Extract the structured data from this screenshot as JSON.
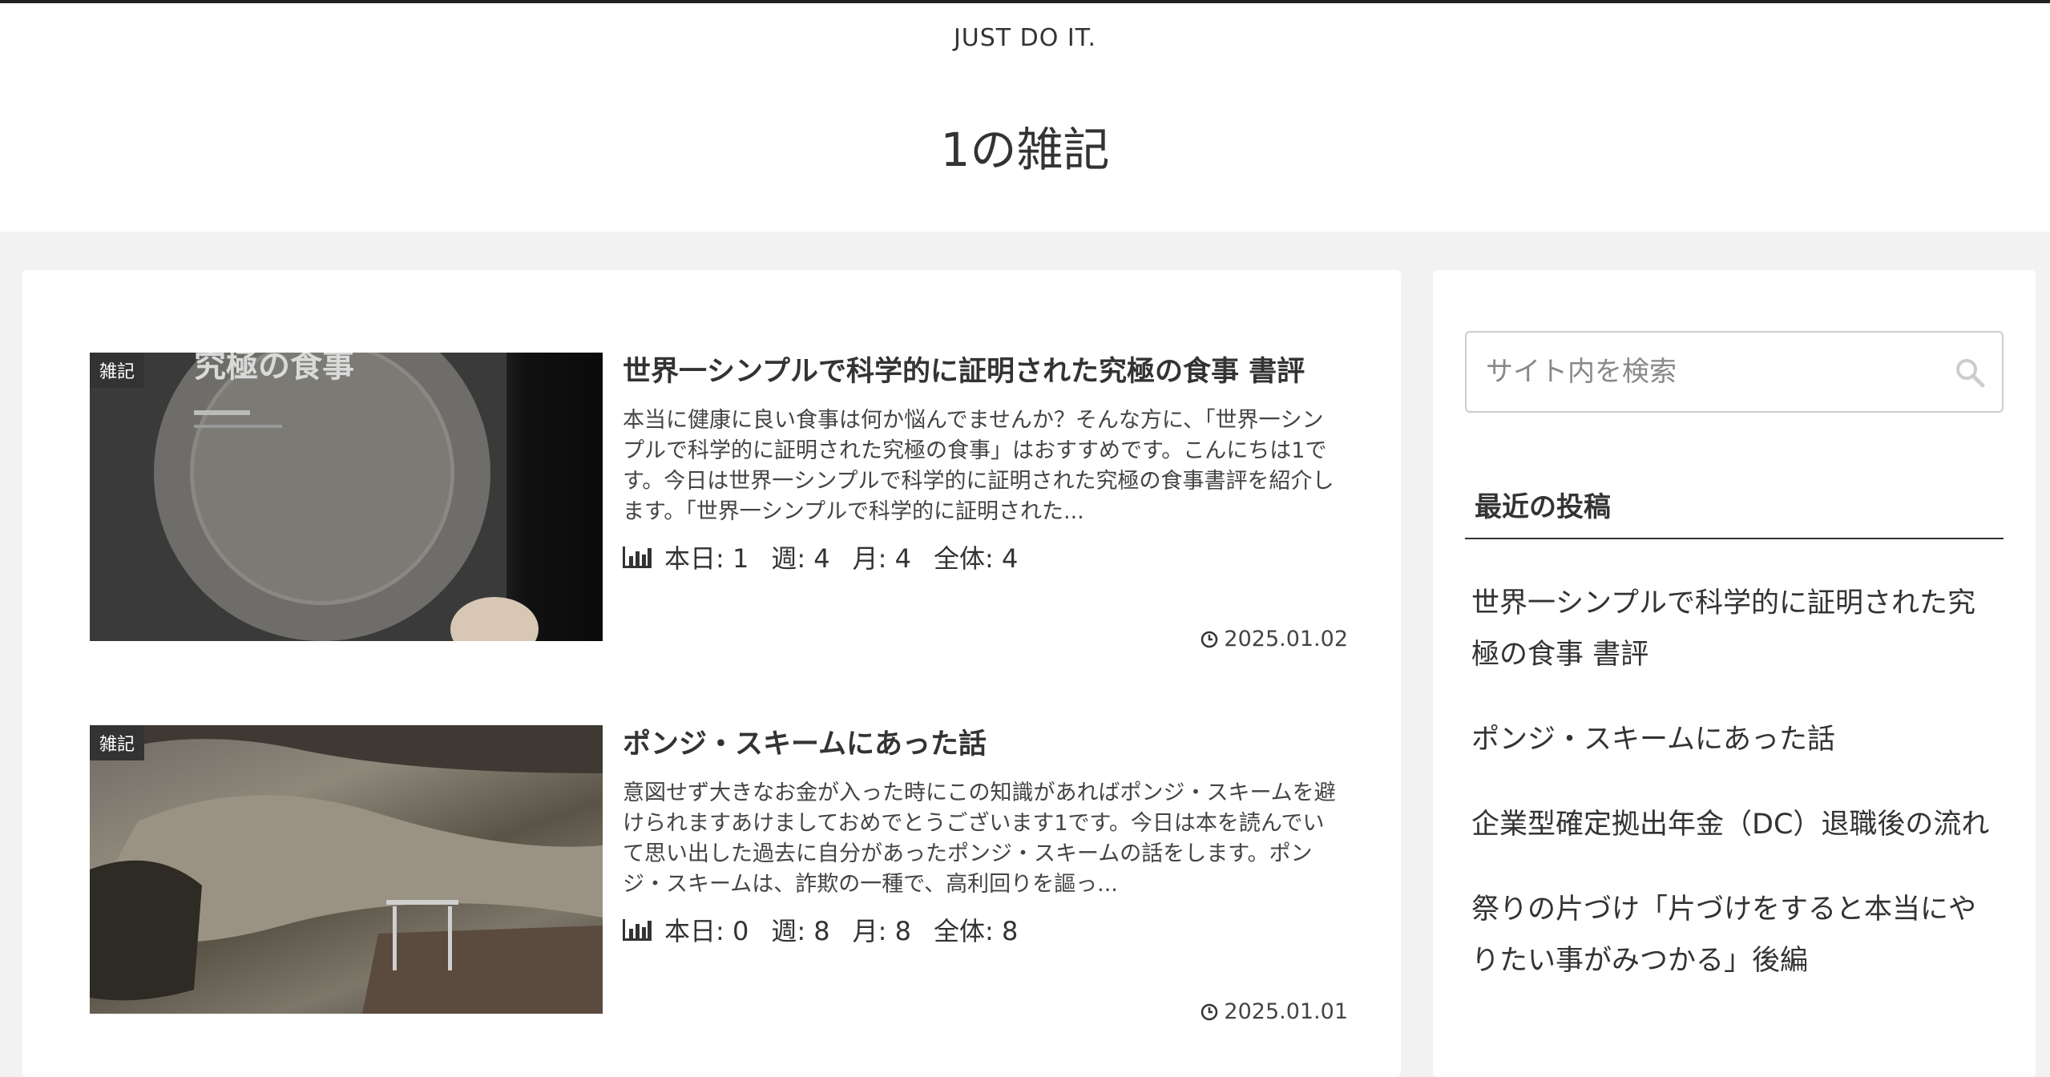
{
  "header": {
    "tagline": "JUST DO IT.",
    "site_title": "1の雑記"
  },
  "posts": [
    {
      "category": "雑記",
      "title": "世界一シンプルで科学的に証明された究極の食事 書評",
      "snippet": "本当に健康に良い食事は何か悩んでませんか？そんな方に、「世界一シンプルで科学的に証明された究極の食事」はおすすめです。こんにちは1です。今日は世界一シンプルで科学的に証明された究極の食事書評を紹介します。「世界一シンプルで科学的に証明された...",
      "stats": {
        "today": "本日: 1",
        "week": "週: 4",
        "month": "月: 4",
        "total": "全体: 4"
      },
      "date": "2025.01.02",
      "thumb_text": "究極の食事"
    },
    {
      "category": "雑記",
      "title": "ポンジ・スキームにあった話",
      "snippet": "意図せず大きなお金が入った時にこの知識があればポンジ・スキームを避けられますあけましておめでとうございます1です。今日は本を読んでいて思い出した過去に自分があったポンジ・スキームの話をします。ポンジ・スキームは、詐欺の一種で、高利回りを謳っ...",
      "stats": {
        "today": "本日: 0",
        "week": "週: 8",
        "month": "月: 8",
        "total": "全体: 8"
      },
      "date": "2025.01.01"
    }
  ],
  "sidebar": {
    "search_placeholder": "サイト内を検索",
    "recent_title": "最近の投稿",
    "recent_posts": [
      "世界一シンプルで科学的に証明された究極の食事 書評",
      "ポンジ・スキームにあった話",
      "企業型確定拠出年金（DC）退職後の流れ",
      "祭りの片づけ「片づけをすると本当にやりたい事がみつかる」後編"
    ]
  },
  "icons": {
    "stats": "bar-chart-icon",
    "date": "clock-icon",
    "search": "search-icon"
  }
}
